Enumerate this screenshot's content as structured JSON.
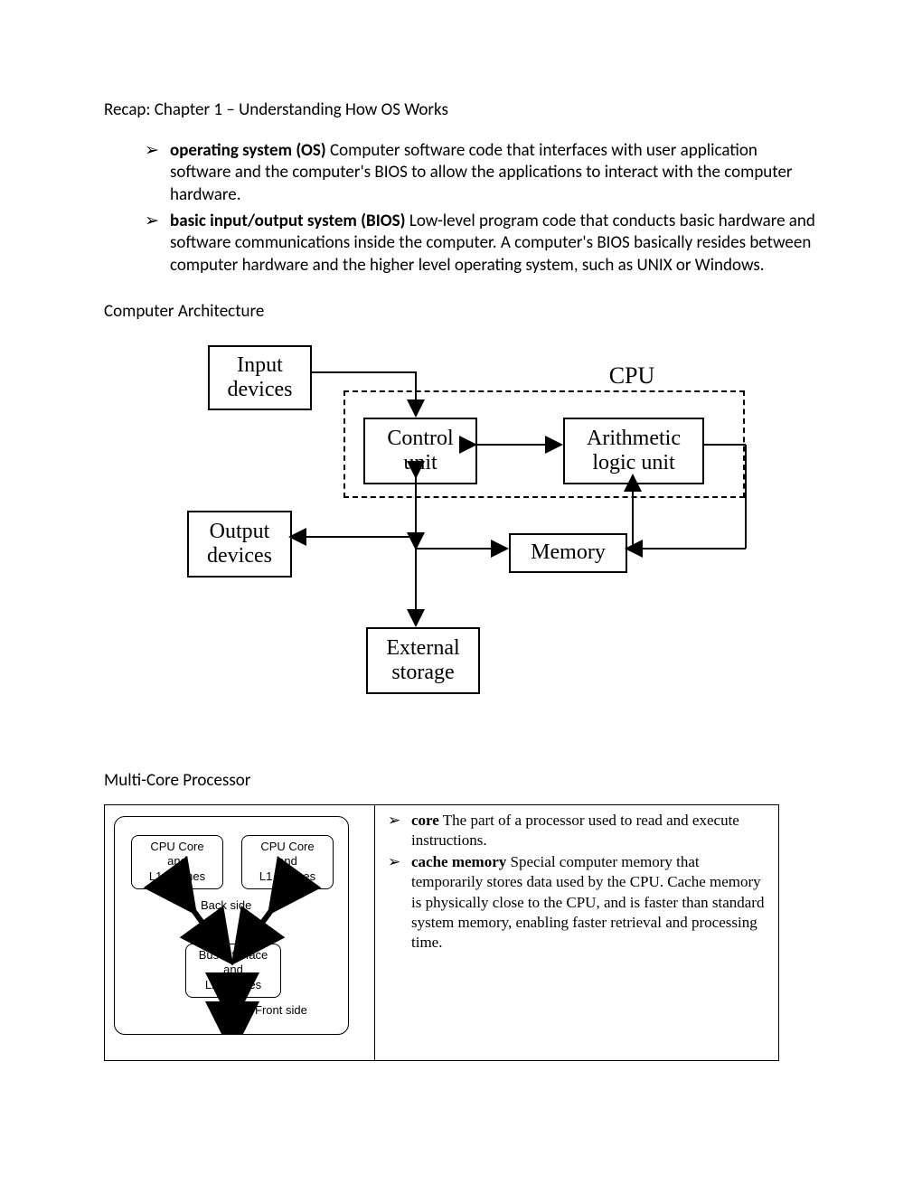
{
  "title": "Recap: Chapter 1 – Understanding How OS Works",
  "defs": [
    {
      "term": "operating system (OS)",
      "text": " Computer software code that interfaces with user application software and the computer's BIOS to allow the applications to interact with the computer hardware."
    },
    {
      "term": "basic input/output system (BIOS)",
      "text": " Low-level program code that conducts basic hardware and software communications inside the computer. A computer's BIOS basically resides between computer hardware and the higher level operating system, such as UNIX or Windows."
    }
  ],
  "arch_head": "Computer Architecture",
  "arch": {
    "input": "Input devices",
    "cpu": "CPU",
    "cu": "Control unit",
    "alu": "Arithmetic logic unit",
    "out": "Output devices",
    "mem": "Memory",
    "ext": "External storage"
  },
  "mc_head": "Multi-Core Processor",
  "mc": {
    "core": "CPU Core\nand\nL1 Caches",
    "bus": "Bus Interface\nand\nL2 Caches",
    "back": "Back side",
    "front": "Front side"
  },
  "defs2": [
    {
      "term": "core",
      "text": " The part of a processor used to read and execute instructions."
    },
    {
      "term": "cache memory",
      "text": " Special computer memory that temporarily stores data used by the CPU. Cache memory is physically close to the CPU, and is faster than standard system memory, enabling faster retrieval and processing time."
    }
  ],
  "arrow": "➢"
}
